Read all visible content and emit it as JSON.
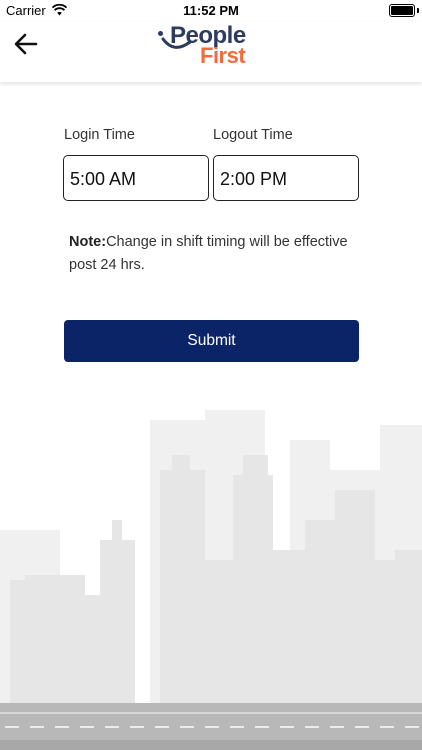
{
  "status_bar": {
    "carrier": "Carrier",
    "time": "11:52 PM",
    "battery_level": 1.0
  },
  "header": {
    "back_icon": "arrow-left-icon",
    "logo": {
      "word1": "People",
      "word2": "First",
      "colors": {
        "primary": "#2d3b5f",
        "accent": "#f26b3a"
      }
    }
  },
  "form": {
    "login_label": "Login Time",
    "login_value": "5:00 AM",
    "logout_label": "Logout Time",
    "logout_value": "2:00 PM"
  },
  "note": {
    "prefix": "Note:",
    "text": "Change in shift timing will be effective post 24 hrs."
  },
  "submit_label": "Submit",
  "colors": {
    "button": "#0b2467",
    "background_art": "#e8e8e8"
  }
}
